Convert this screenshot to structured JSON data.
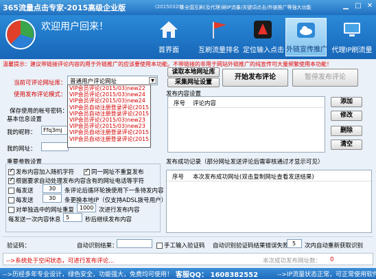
{
  "window": {
    "title": "365流量点击专家-2015高级企业版",
    "version": "(20150320)",
    "subtitle": "集全国互刷(及代理)刷IP流量/关键词点击/外链推广等强大功能"
  },
  "header": {
    "welcome": "欢迎用户回来！",
    "nav": [
      {
        "label": "首界面"
      },
      {
        "label": "互刷流量排名"
      },
      {
        "label": "定位输入点击"
      },
      {
        "label": "外链宣传推广"
      },
      {
        "label": "代理IP刷流量"
      }
    ]
  },
  "notice": {
    "line1": "温馨提示：建议带链接评论内容的用于外链推广的应该要使用本功能。不带链接的非用于网站外链推广的纯宣传可大量频繁使用本功能！",
    "line2": ""
  },
  "left": {
    "current_url_label": "当前可评论网址库：",
    "current_url_value": "普通用户评论网址",
    "mode_label": "使用发布评论模式：",
    "saved_label": "保存使用的帐号密码：",
    "basic_info_label": "基本信息设置",
    "nickname_label": "我的昵称：",
    "nickname_value": "Ffq3mj",
    "url_label": "我的网址：",
    "dropdown_items": [
      "VIP会员评论(2015/03)new22",
      "VIP会员评论(2015/03)new24",
      "VIP会员评论(2015/03)new24",
      "VIP会员自动注册登录评论(2015",
      "VIP会员自动注册登录评论(2015",
      "VIP会员评论(2015/03)new23",
      "VIP会员评论(2015/03)new23",
      "VIP会员自动注册登录评论(2015",
      "VIP会员自动注册登录评论(2015"
    ]
  },
  "buttons": {
    "read_local": "读取本地网址库",
    "collect": "采集网址设置",
    "start": "开始发布评论",
    "pause": "暂停发布评论",
    "add": "添加",
    "edit": "修改",
    "delete": "删除",
    "clear": "清空"
  },
  "comment_settings": {
    "title": "发布内容设置",
    "col_no": "序号",
    "col_content": "评论内容"
  },
  "params": {
    "title": "重要参数设置",
    "opt1": "发布内容加入随机字符",
    "opt2": "同一网址不重复发布",
    "opt3": "根据要求自动处理发布内容含有的网址电话等字符",
    "opt4a": "每发送",
    "opt4_value": "30",
    "opt4b": "条评论后循环轮换使用下一条待发内容",
    "opt5a": "每发送",
    "opt5_value": "30",
    "opt5b": "条更换本地IP（仅支持ADSL拨号用户）",
    "opt6a": "对单独选中的网址重复",
    "opt6_value": "1000",
    "opt6b": "次进行发布内容",
    "opt7a": "每发送一次内容休息",
    "opt7_value": "5",
    "opt7b": "秒后继续发布内容"
  },
  "success": {
    "title": "发布成功记录（部分网址发送评论后需审核通过才显示可见）",
    "col_no": "序号",
    "col_url": "本次发布成功网址(双击复制网址查看发送结果)"
  },
  "captcha": {
    "label": "验证码：",
    "auto_label": "自动识别结果：",
    "manual_label": "手工输入验证码",
    "fail_label": "自动识别验证码结果错误失败数",
    "fail_value": "5",
    "fail_tail": "次内自动重新获取识别"
  },
  "status": {
    "message": "-->系统处于空闲状态，可进行发布评论...",
    "count_label": "本次成功发布网址数：",
    "count_value": "0"
  },
  "footer": {
    "left": "-->历经多年专业设计，绿色安全，功能强大，免费均可使用！",
    "qq": "客服QQ： 1608382552",
    "right": "-->IP流量状态正常，可正常使用软件..."
  }
}
